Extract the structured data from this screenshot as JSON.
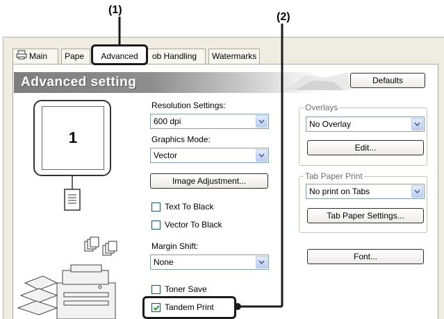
{
  "callouts": {
    "one": "(1)",
    "two": "(2)"
  },
  "tabs": [
    {
      "label": "Main"
    },
    {
      "label": "Pape"
    },
    {
      "label": "Advanced"
    },
    {
      "label": "ob Handling"
    },
    {
      "label": "Watermarks"
    }
  ],
  "header": {
    "title": "Advanced setting",
    "defaults_label": "Defaults"
  },
  "preview": {
    "page_number": "1"
  },
  "center": {
    "resolution_label": "Resolution Settings:",
    "resolution_value": "600 dpi",
    "graphics_label": "Graphics Mode:",
    "graphics_value": "Vector",
    "image_adjustment_label": "Image Adjustment...",
    "text_to_black_label": "Text To Black",
    "text_to_black_checked": false,
    "vector_to_black_label": "Vector To Black",
    "vector_to_black_checked": false,
    "margin_shift_label": "Margin Shift:",
    "margin_shift_value": "None",
    "toner_save_label": "Toner Save",
    "toner_save_checked": false,
    "tandem_print_label": "Tandem Print",
    "tandem_print_checked": true
  },
  "right": {
    "overlays_title": "Overlays",
    "overlays_value": "No Overlay",
    "edit_label": "Edit...",
    "tab_paper_title": "Tab Paper Print",
    "tab_paper_value": "No print on Tabs",
    "tab_paper_settings_label": "Tab Paper Settings...",
    "font_label": "Font..."
  },
  "colors": {
    "highlight_border": "#1a1a1a",
    "dialog_bg": "#efede1",
    "select_border": "#7f9db9"
  }
}
